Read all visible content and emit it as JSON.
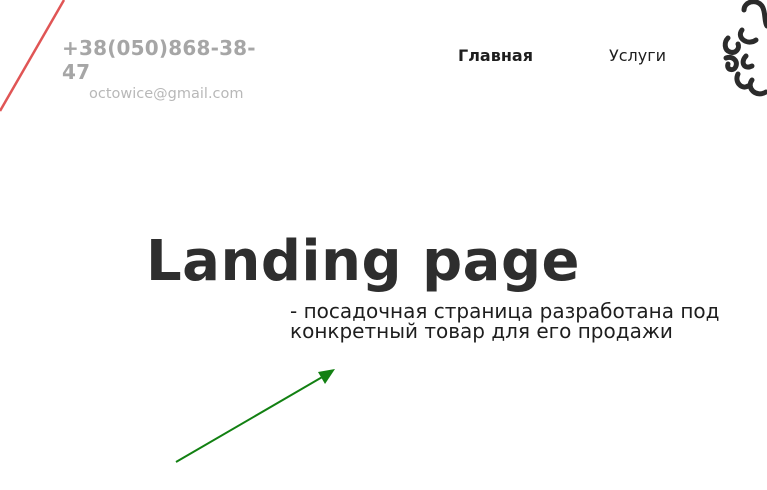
{
  "header": {
    "phone": "+38(050)868-38-47",
    "email": "octowice@gmail.com"
  },
  "nav": {
    "items": [
      {
        "label": "Главная",
        "active": true
      },
      {
        "label": "Услуги",
        "active": false
      }
    ]
  },
  "logo": {
    "icon": "octopus-logo-icon",
    "color": "#2b2b2b"
  },
  "hero": {
    "title": "Landing page",
    "subtitle_line1": "- посадочная страница разработана под",
    "subtitle_line2": "конкретный товар для его продажи"
  },
  "decorations": {
    "top_line_color": "#e05555",
    "arrow_color": "#128012"
  }
}
